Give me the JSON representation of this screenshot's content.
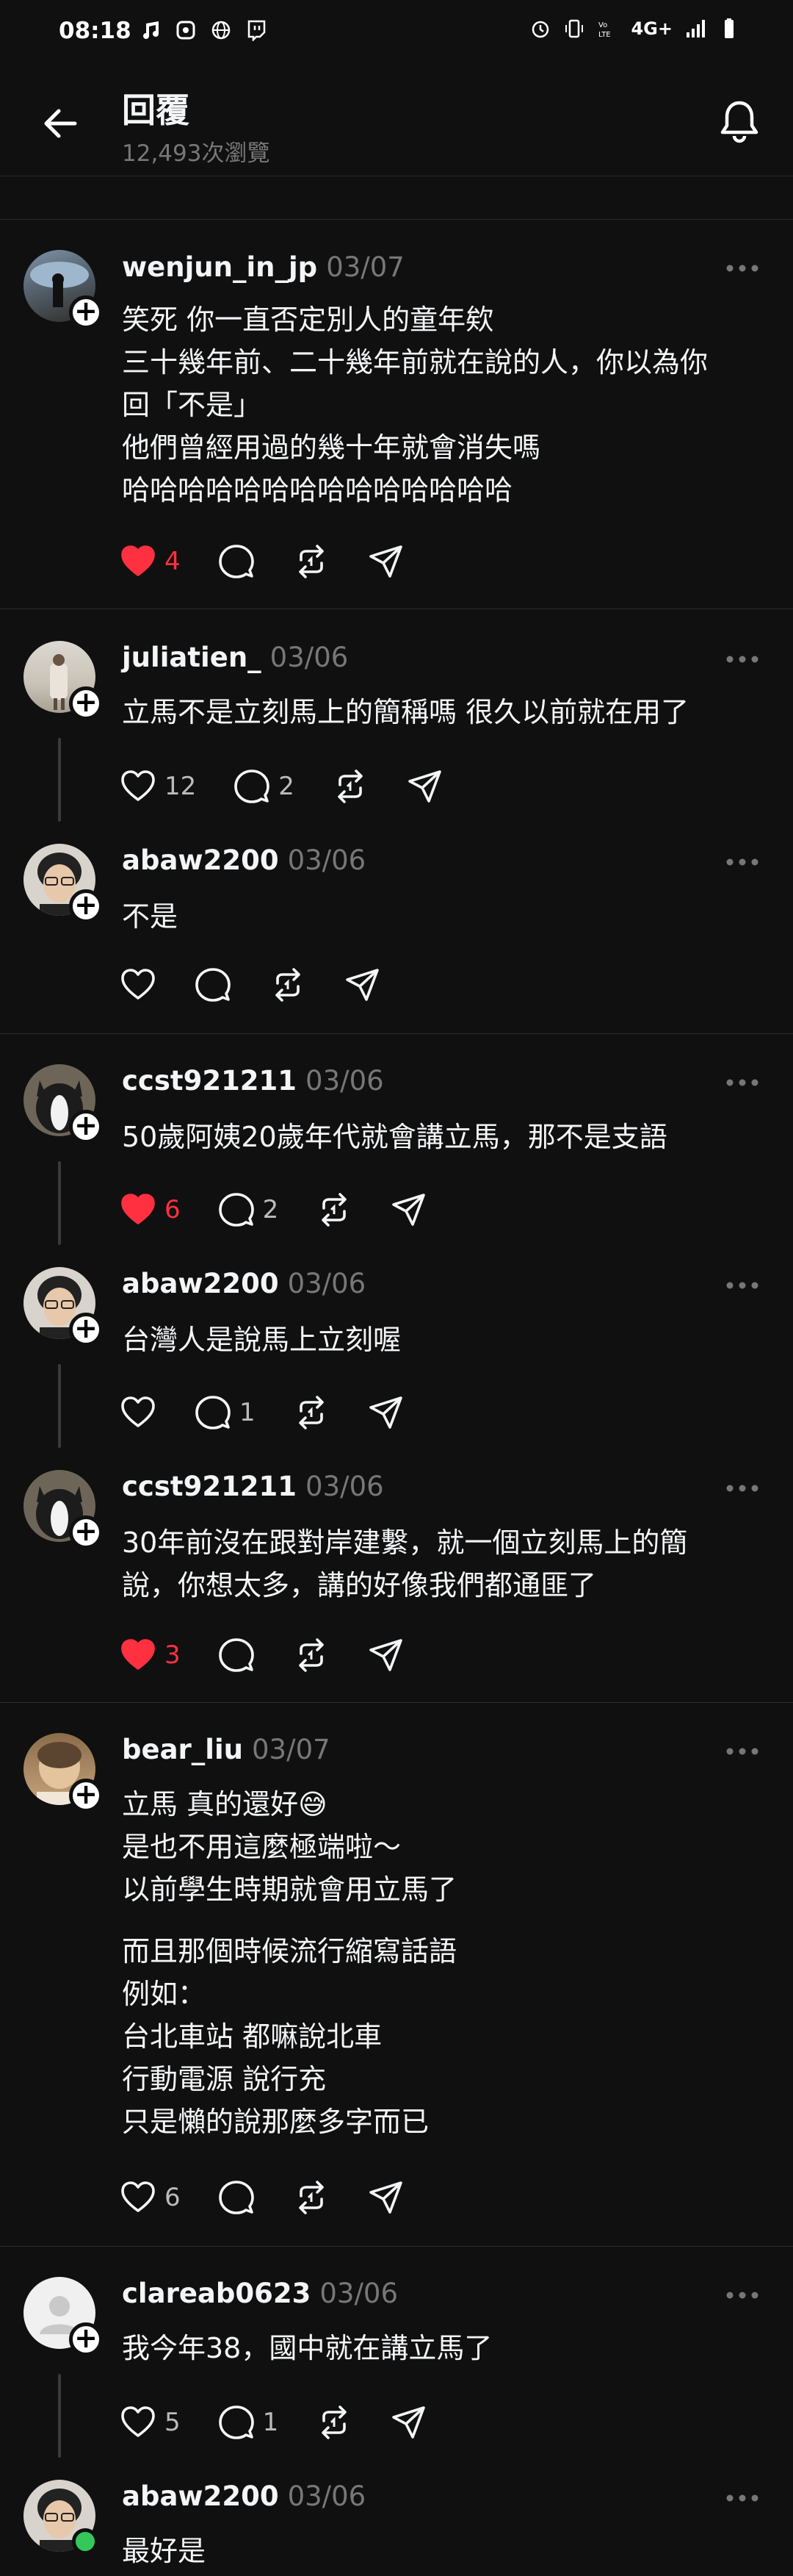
{
  "status_bar": {
    "time": "08:18",
    "network": "4G+"
  },
  "header": {
    "title": "回覆",
    "views": "12,493次瀏覽"
  },
  "posts": [
    {
      "username": "wenjun_in_jp",
      "date": "03/07",
      "lines": [
        "笑死 你一直否定別人的童年欸",
        "三十幾年前、二十幾年前就在說的人，你以為你",
        "回「不是」",
        "他們曾經用過的幾十年就會消失嗎",
        "哈哈哈哈哈哈哈哈哈哈哈哈哈哈"
      ],
      "likes": "4",
      "comments": "",
      "liked": true
    },
    {
      "username": "juliatien_",
      "date": "03/06",
      "lines": [
        "立馬不是立刻馬上的簡稱嗎 很久以前就在用了"
      ],
      "likes": "12",
      "comments": "2",
      "liked": false
    },
    {
      "username": "abaw2200",
      "date": "03/06",
      "lines": [
        "不是"
      ],
      "likes": "",
      "comments": "",
      "liked": false
    },
    {
      "username": "ccst921211",
      "date": "03/06",
      "lines": [
        "50歲阿姨20歲年代就會講立馬，那不是支語"
      ],
      "likes": "6",
      "comments": "2",
      "liked": true
    },
    {
      "username": "abaw2200",
      "date": "03/06",
      "lines": [
        "台灣人是說馬上立刻喔"
      ],
      "likes": "",
      "comments": "1",
      "liked": false
    },
    {
      "username": "ccst921211",
      "date": "03/06",
      "lines": [
        "30年前沒在跟對岸建繫，就一個立刻馬上的簡",
        "說，你想太多，講的好像我們都通匪了"
      ],
      "likes": "3",
      "comments": "",
      "liked": true
    },
    {
      "username": "bear_liu",
      "date": "03/07",
      "lines": [
        "立馬 真的還好😅",
        "是也不用這麼極端啦～",
        "以前學生時期就會用立馬了",
        "",
        "而且那個時候流行縮寫話語",
        "例如：",
        "台北車站 都嘛說北車",
        "行動電源 說行充",
        "只是懶的說那麼多字而已"
      ],
      "likes": "6",
      "comments": "",
      "liked": false
    },
    {
      "username": "clareab0623",
      "date": "03/06",
      "lines": [
        "我今年38，國中就在講立馬了"
      ],
      "likes": "5",
      "comments": "1",
      "liked": false
    },
    {
      "username": "abaw2200",
      "date": "03/06",
      "lines": [
        "最好是"
      ],
      "likes": "",
      "comments": "",
      "liked": false
    }
  ],
  "colors": {
    "background": "#101010",
    "like_red": "#ff3040",
    "muted": "#777777",
    "online_green": "#34c759"
  }
}
